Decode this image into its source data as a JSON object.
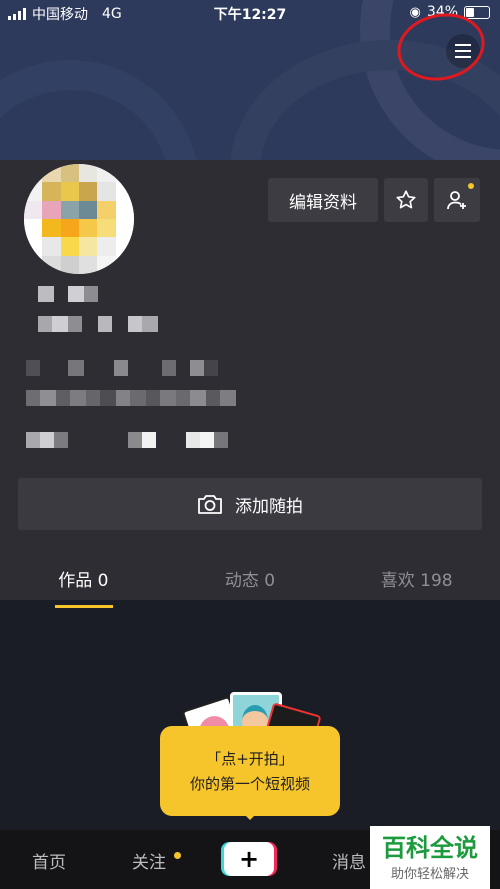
{
  "status_bar": {
    "carrier": "中国移动",
    "network": "4G",
    "time": "下午12:27",
    "battery": "34%"
  },
  "profile": {
    "edit_label": "编辑资料",
    "camera_label": "添加随拍"
  },
  "tabs": [
    {
      "label": "作品 0"
    },
    {
      "label": "动态 0"
    },
    {
      "label": "喜欢 198"
    }
  ],
  "empty_state": {
    "line1": "「点+开拍」",
    "line2": "你的第一个短视频"
  },
  "bottom_nav": {
    "home": "首页",
    "follow": "关注",
    "plus": "+",
    "messages": "消息"
  },
  "watermark": {
    "title": "百科全说",
    "subtitle": "助你轻松解决"
  },
  "colors": {
    "accent": "#f6c42b",
    "annotation": "#e0191f"
  },
  "icons": [
    "signal-icon",
    "battery-icon",
    "menu-icon",
    "star-icon",
    "add-friend-icon",
    "camera-icon"
  ]
}
